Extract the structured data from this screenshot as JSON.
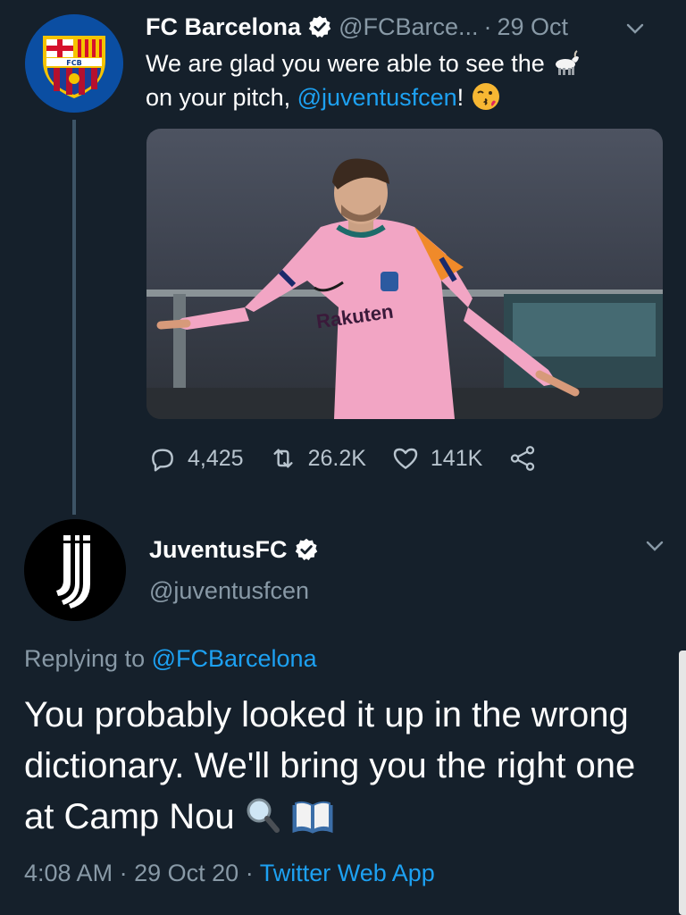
{
  "tweet1": {
    "name": "FC Barcelona",
    "handle": "@FCBarce...",
    "date": "29 Oct",
    "separator": "·",
    "text_part1": "We are glad you were able to see the",
    "text_part2": "on your pitch,",
    "mention": "@juventusfcen",
    "text_part3": "!",
    "emoji1": "goat-emoji",
    "emoji2": "kiss-emoji",
    "media_text": "Rakuten",
    "stats": {
      "replies": "4,425",
      "retweets": "26.2K",
      "likes": "141K"
    }
  },
  "tweet2": {
    "name": "JuventusFC",
    "handle": "@juventusfcen",
    "replying_label": "Replying to",
    "replying_to": "@FCBarcelona",
    "text": "You probably looked it up in the wrong dictionary. We'll bring you the right one at Camp Nou",
    "emojis": [
      "magnifying-glass-emoji",
      "open-book-emoji"
    ],
    "time": "4:08 AM",
    "date": "29 Oct 20",
    "separator": "·",
    "source": "Twitter Web App"
  },
  "colors": {
    "background": "#15202b",
    "accent": "#1da1f2",
    "muted": "#8899a6"
  }
}
